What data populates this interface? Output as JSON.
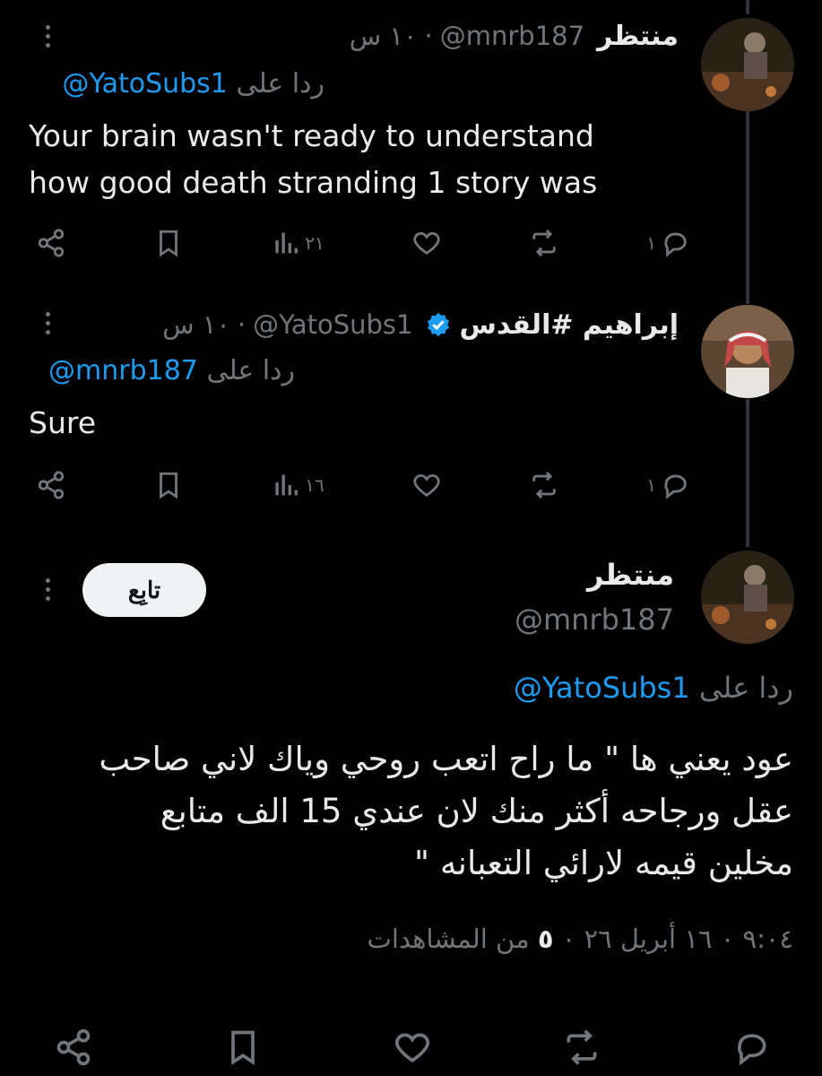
{
  "reply1": {
    "name": "منتظر",
    "handle": "@mnrb187",
    "time": "١٠ س",
    "replying_prefix": "ردا على",
    "replying_handle": "@YatoSubs1",
    "body_lines": [
      "Your brain wasn't ready to understand",
      "how good death stranding 1 story was"
    ],
    "views": "٢١",
    "replies": "١"
  },
  "reply2": {
    "name": "إبراهيم #القدس",
    "handle": "@YatoSubs1",
    "time": "١٠ س",
    "replying_prefix": "ردا على",
    "replying_handle": "@mnrb187",
    "body": "Sure",
    "views": "١٦",
    "replies": "١"
  },
  "main": {
    "name": "منتظر",
    "handle": "@mnrb187",
    "follow_label": "تابِع",
    "replying_prefix": "ردا على",
    "replying_handle": "@YatoSubs1",
    "body_lines": [
      "عود يعني ها \" ما راح اتعب روحي وياك لاني صاحب",
      "عقل ورجاحه أكثر منك لان عندي 15 الف متابع",
      "مخلين قيمه لارائي التعبانه \""
    ],
    "timestamp": "٩:٠٤ ٠ ١٦ أبريل ٢٦ ٠",
    "views_count": "٥",
    "views_label": "من المشاهدات"
  },
  "colors": {
    "accent": "#1d9bf0",
    "muted": "#71767b",
    "text": "#e7e9ea",
    "background": "#000000"
  }
}
